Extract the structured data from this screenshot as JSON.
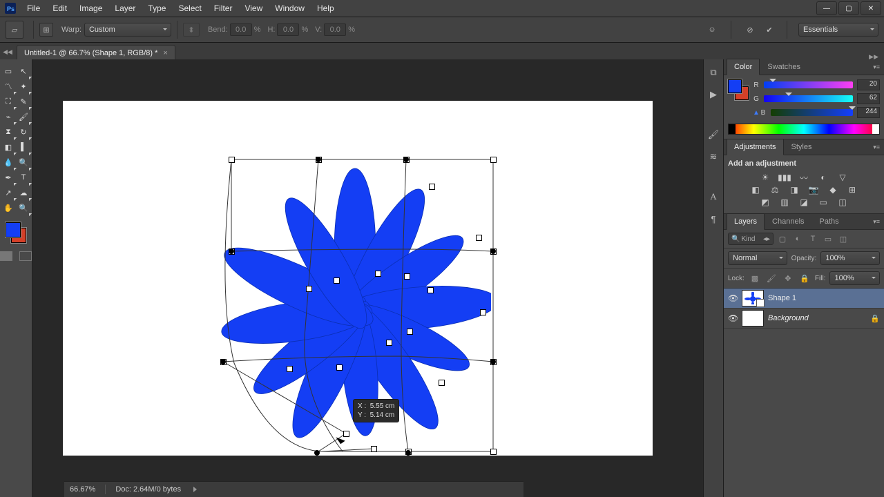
{
  "menu": {
    "items": [
      "File",
      "Edit",
      "Image",
      "Layer",
      "Type",
      "Select",
      "Filter",
      "View",
      "Window",
      "Help"
    ]
  },
  "optionsbar": {
    "warp_label": "Warp:",
    "warp_preset": "Custom",
    "bend_label": "Bend:",
    "bend_value": "0.0",
    "pct": "%",
    "h_label": "H:",
    "h_value": "0.0",
    "v_label": "V:",
    "v_value": "0.0",
    "workspace": "Essentials"
  },
  "document": {
    "tab": "Untitled-1 @ 66.7% (Shape 1, RGB/8) *"
  },
  "tooltip": {
    "x_label": "X :",
    "x_value": "5.55 cm",
    "y_label": "Y :",
    "y_value": "5.14 cm"
  },
  "panels": {
    "color_tab": "Color",
    "swatches_tab": "Swatches",
    "adjustments_tab": "Adjustments",
    "styles_tab": "Styles",
    "layers_tab": "Layers",
    "channels_tab": "Channels",
    "paths_tab": "Paths"
  },
  "color": {
    "r_label": "R",
    "r_value": "20",
    "g_label": "G",
    "g_value": "62",
    "b_label": "B",
    "b_value": "244",
    "fg_hex": "#143ef4",
    "bg_hex": "#d54028",
    "warn": "▲"
  },
  "adjustments": {
    "add_label": "Add an adjustment"
  },
  "layers": {
    "kind": "Kind",
    "blend": "Normal",
    "opacity_label": "Opacity:",
    "opacity_value": "100%",
    "lock_label": "Lock:",
    "fill_label": "Fill:",
    "fill_value": "100%",
    "items": [
      {
        "name": "Shape 1",
        "italic": false,
        "locked": false,
        "thumb": "flower"
      },
      {
        "name": "Background",
        "italic": true,
        "locked": true,
        "thumb": "white"
      }
    ]
  },
  "status": {
    "zoom": "66.67%",
    "doc": "Doc: 2.64M/0 bytes"
  },
  "colors": {
    "tool_fg": "#143ef4",
    "tool_bg": "#d54028"
  }
}
